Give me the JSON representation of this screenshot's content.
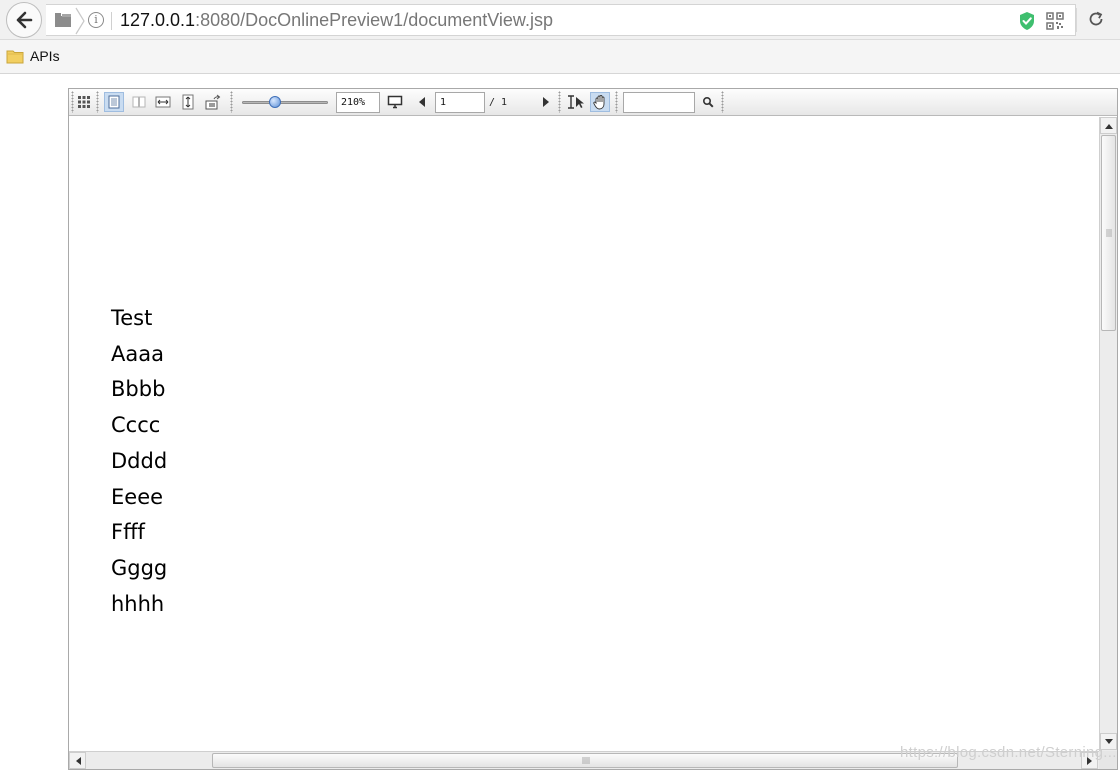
{
  "browser": {
    "url_host": "127.0.0.1",
    "url_rest": ":8080/DocOnlinePreview1/documentView.jsp",
    "icons": [
      "back-arrow-icon",
      "site-icon",
      "info-icon",
      "shield-icon",
      "qr-code-icon",
      "refresh-icon"
    ]
  },
  "bookmarks": [
    {
      "label": "APIs",
      "icon": "folder-icon"
    }
  ],
  "toolbar": {
    "zoom_value": "210%",
    "zoom_level_fraction": 0.38,
    "page_current": "1",
    "page_total": "/ 1",
    "search_value": ""
  },
  "document": {
    "lines": [
      "Test",
      "Aaaa",
      "Bbbb",
      "Cccc",
      "Dddd",
      "Eeee",
      "Ffff",
      "Gggg",
      "hhhh"
    ]
  },
  "watermark": "https://blog.csdn.net/Sterning..."
}
